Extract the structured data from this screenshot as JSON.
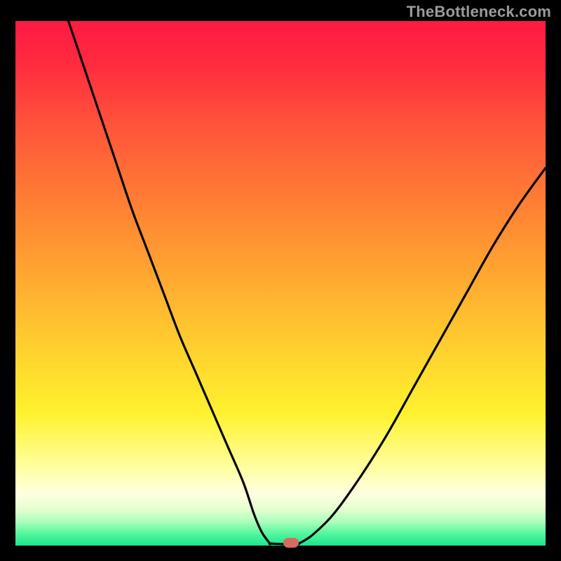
{
  "watermark": "TheBottleneck.com",
  "colors": {
    "bg": "#000000",
    "watermark": "#9b9b9b",
    "curve": "#000000",
    "marker": "#d86a5f",
    "gradient_stops": [
      {
        "offset": 0.0,
        "color": "#ff1a42"
      },
      {
        "offset": 0.08,
        "color": "#ff2b3f"
      },
      {
        "offset": 0.2,
        "color": "#ff543a"
      },
      {
        "offset": 0.35,
        "color": "#ff8034"
      },
      {
        "offset": 0.5,
        "color": "#ffab30"
      },
      {
        "offset": 0.63,
        "color": "#ffd22e"
      },
      {
        "offset": 0.75,
        "color": "#fff22f"
      },
      {
        "offset": 0.85,
        "color": "#ffffa0"
      },
      {
        "offset": 0.9,
        "color": "#ffffe0"
      },
      {
        "offset": 0.93,
        "color": "#e5ffd0"
      },
      {
        "offset": 0.955,
        "color": "#a8ffbb"
      },
      {
        "offset": 0.975,
        "color": "#5cf7a0"
      },
      {
        "offset": 1.0,
        "color": "#18e78c"
      }
    ]
  },
  "chart_data": {
    "type": "line",
    "title": "",
    "xlabel": "",
    "ylabel": "",
    "xlim": [
      0,
      100
    ],
    "ylim": [
      0,
      100
    ],
    "grid": false,
    "legend": false,
    "annotations": [],
    "series": [
      {
        "name": "left-branch",
        "x": [
          10,
          13,
          16,
          19,
          22,
          25,
          28,
          31,
          34,
          37,
          40,
          43,
          45,
          46.5,
          48
        ],
        "y": [
          100,
          91,
          82,
          73,
          64,
          56,
          48,
          40,
          33,
          26,
          19,
          12,
          6,
          2.5,
          0.4
        ]
      },
      {
        "name": "valley-flat",
        "x": [
          48,
          50,
          52,
          53.5
        ],
        "y": [
          0.4,
          0.3,
          0.3,
          0.4
        ]
      },
      {
        "name": "right-branch",
        "x": [
          53.5,
          56,
          60,
          65,
          70,
          75,
          80,
          85,
          90,
          95,
          100
        ],
        "y": [
          0.4,
          2,
          6,
          13,
          21,
          30,
          39,
          48,
          57,
          65,
          72
        ]
      }
    ],
    "marker": {
      "x": 52,
      "y": 0.6
    }
  }
}
